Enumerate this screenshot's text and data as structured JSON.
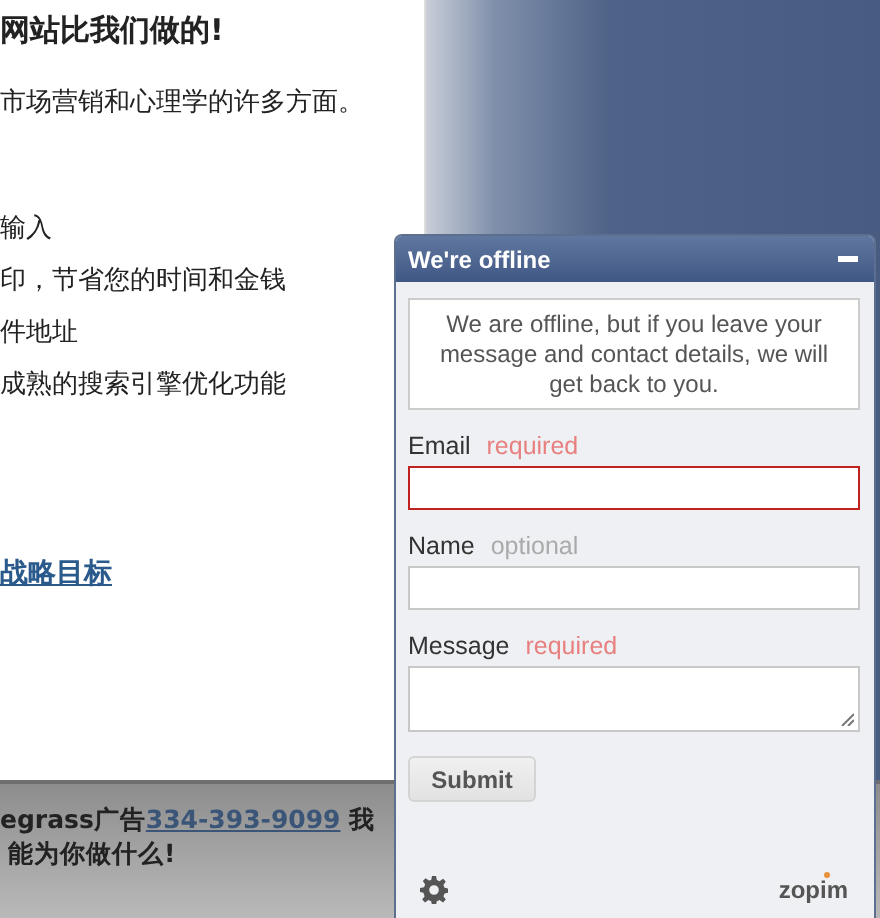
{
  "article": {
    "heading": "网站比我们做的!",
    "paragraphs": [
      "市场营销和心理学的许多方面。",
      "输入",
      "印，节省您的时间和金钱",
      "件地址",
      "成熟的搜索引擎优化功能"
    ],
    "link": "战略目标"
  },
  "footer_bar": {
    "text": "egrass广告",
    "phone_link": "334-393-9099",
    "tail": "我",
    "line_2": "能为你做什么!"
  },
  "chat": {
    "title": "We're offline",
    "notice": "We are offline, but if you leave your message and contact details, we will get back to you.",
    "fields": [
      {
        "label": "Email",
        "hint": "required",
        "required": true,
        "kind": "input",
        "invalid": true
      },
      {
        "label": "Name",
        "hint": "optional",
        "required": false,
        "kind": "input",
        "invalid": false
      },
      {
        "label": "Message",
        "hint": "required",
        "required": true,
        "kind": "textarea",
        "invalid": false
      }
    ],
    "submit": "Submit",
    "brand": "zopim"
  }
}
